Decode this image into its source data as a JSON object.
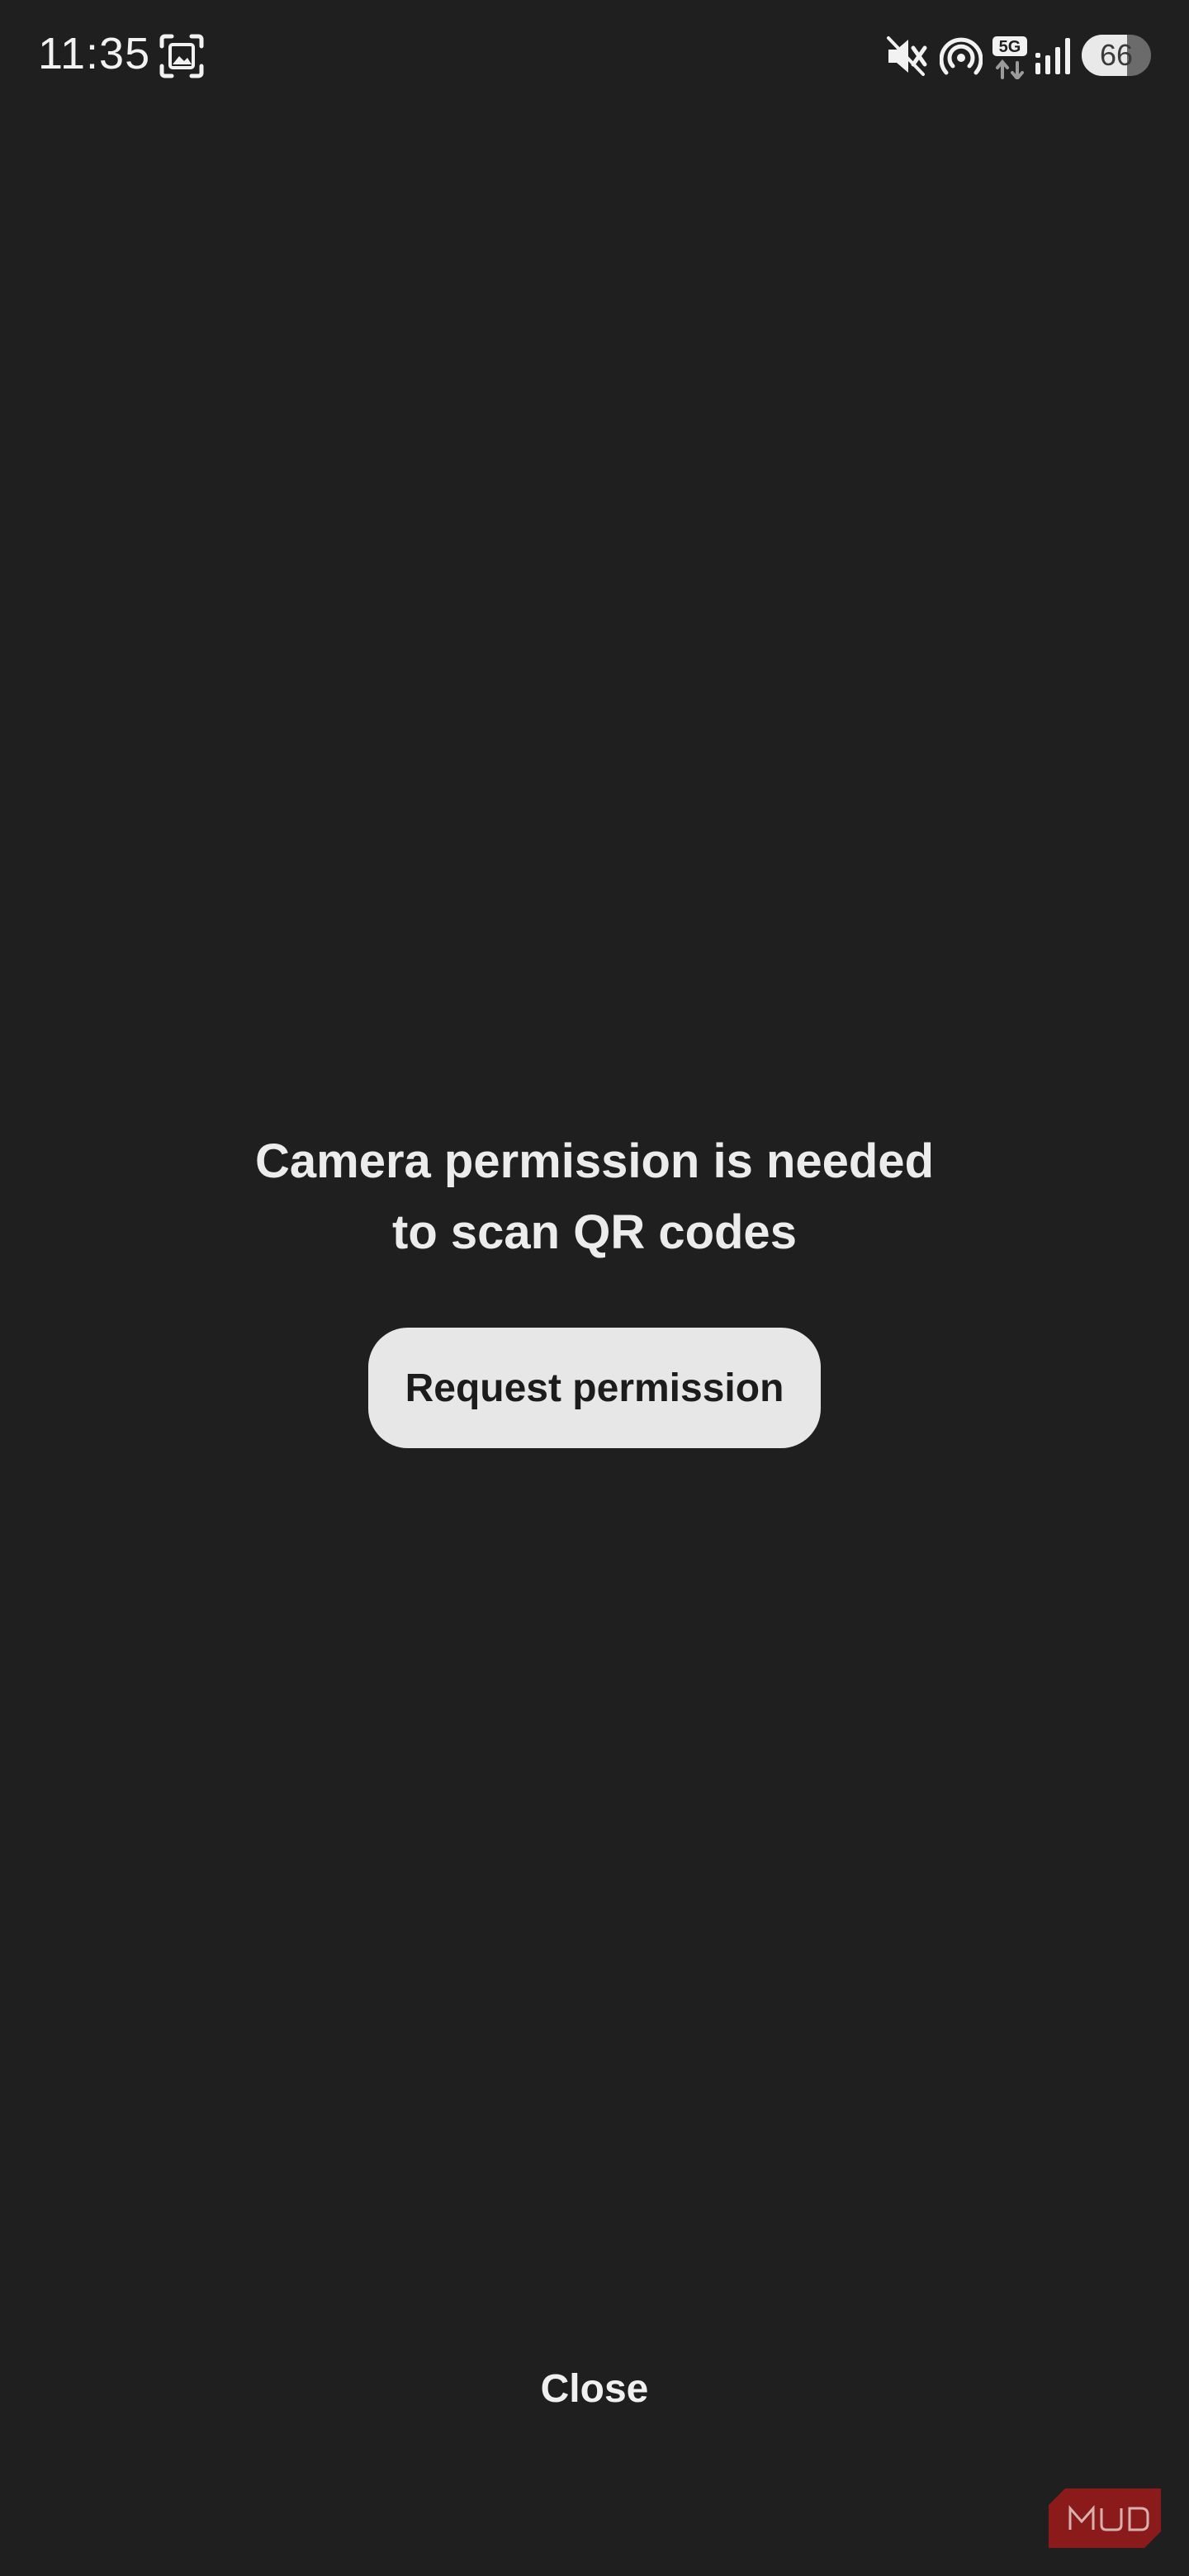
{
  "status_bar": {
    "time": "11:35",
    "battery_level": "66",
    "battery_fraction": 0.66,
    "network_type": "5G",
    "icons": [
      "screenshot-icon",
      "mute-icon",
      "hotspot-icon",
      "5g-network-icon",
      "signal-icon",
      "battery-icon"
    ]
  },
  "main": {
    "message_line1": "Camera permission is needed",
    "message_line2": "to scan QR codes",
    "request_button_label": "Request permission",
    "close_label": "Close"
  },
  "watermark": {
    "text": "MUO",
    "color": "#8b1a1a"
  },
  "colors": {
    "background": "#1f1f1f",
    "button_background": "#e7e7e7",
    "text": "#ececec"
  }
}
